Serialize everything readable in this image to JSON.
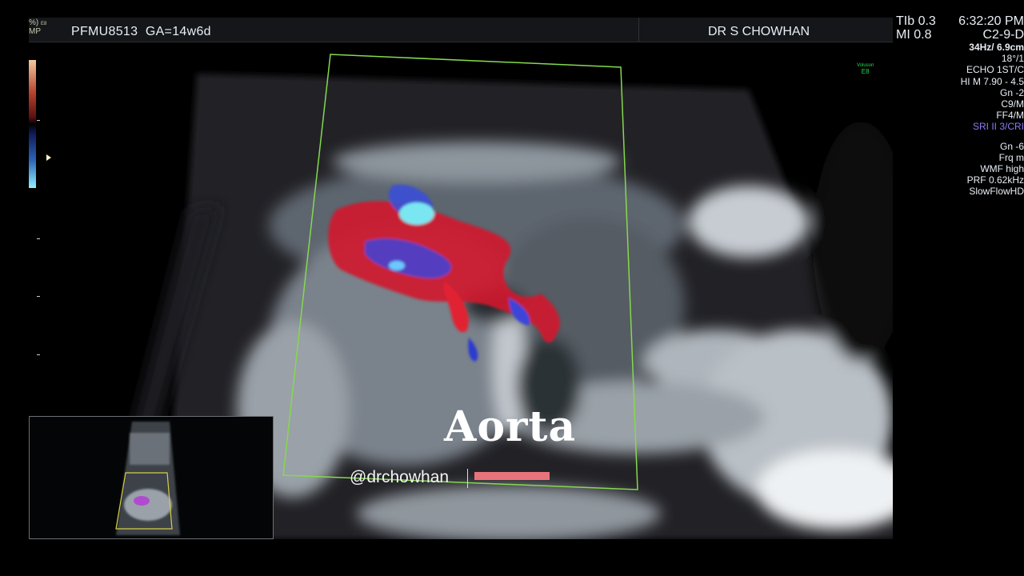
{
  "header": {
    "mode_line1": "%)",
    "mode_line1_sub": "E8",
    "mode_line2": "MP",
    "patient_id": "PFMU8513",
    "gestational_age": "GA=14w6d",
    "doctor": "DR S CHOWHAN"
  },
  "readouts": {
    "tib": "TIb 0.3",
    "mi": "MI 0.8",
    "time": "6:32:20 PM",
    "probe": "C2-9-D",
    "frame": "34Hz/ 6.9cm",
    "angle": "18°/1",
    "preset": "ECHO 1ST/C",
    "harmonics": "HI M  7.90 - 4.5",
    "gain": "Gn -2",
    "c": "C9/M",
    "ff": "FF4/M",
    "sri": "SRI II 3/CRI",
    "color_gain": "Gn -6",
    "frq": "Frq m",
    "wmf": "WMF high",
    "prf": "PRF 0.62kHz",
    "flow": "SlowFlowHD"
  },
  "logo": {
    "brand": "Voluson",
    "model": "E8"
  },
  "overlay": {
    "label": "Aorta",
    "handle": "@drchowhan"
  },
  "colors": {
    "roi_box": "#86d84e",
    "label_bar": "#e8737a",
    "doppler_red": "#e0182a",
    "doppler_blue": "#2a4fd8",
    "doppler_cyan": "#7ae6f2"
  }
}
